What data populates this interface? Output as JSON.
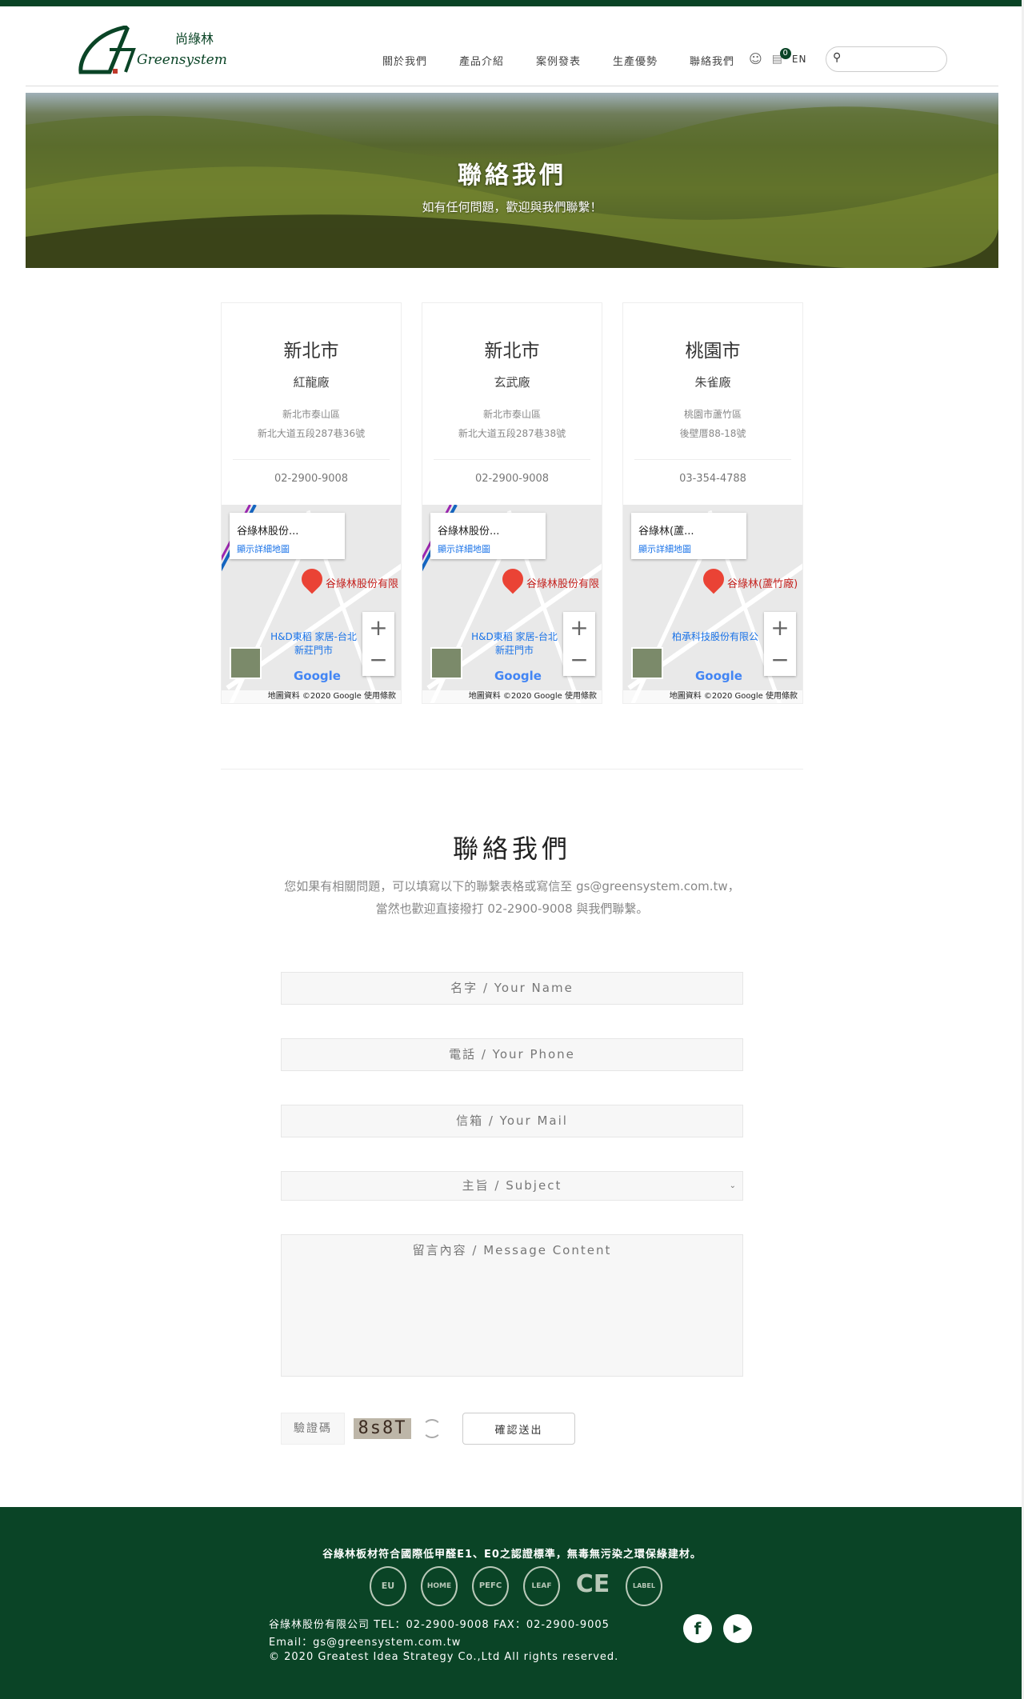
{
  "header": {
    "logo_text": "尚綠林 Greensystem",
    "nav": [
      "關於我們",
      "產品介紹",
      "案例發表",
      "生產優勢",
      "聯絡我們"
    ],
    "cart_count": "0",
    "lang": "EN",
    "search_placeholder": ""
  },
  "hero": {
    "title": "聯絡我們",
    "subtitle": "如有任何問題，歡迎與我們聯繫！"
  },
  "locations": [
    {
      "city": "新北市",
      "factory": "紅龍廠",
      "addr1": "新北市泰山區",
      "addr2": "新北大道五段287巷36號",
      "tel": "02-2900-9008",
      "map_title": "谷綠林股份...",
      "map_link": "顯示詳細地圖",
      "pin_label": "谷綠林股份有限",
      "poi": "H&D東稻 家居-台北新莊門市"
    },
    {
      "city": "新北市",
      "factory": "玄武廠",
      "addr1": "新北市泰山區",
      "addr2": "新北大道五段287巷38號",
      "tel": "02-2900-9008",
      "map_title": "谷綠林股份...",
      "map_link": "顯示詳細地圖",
      "pin_label": "谷綠林股份有限",
      "poi": "H&D東稻 家居-台北新莊門市"
    },
    {
      "city": "桃園市",
      "factory": "朱雀廠",
      "addr1": "桃園市蘆竹區",
      "addr2": "後壁厝88-18號",
      "tel": "03-354-4788",
      "map_title": "谷綠林(蘆...",
      "map_link": "顯示詳細地圖",
      "pin_label": "谷綠林(蘆竹廠)",
      "poi": "柏承科技股份有限公"
    }
  ],
  "map_common": {
    "google": "Google",
    "attribution": "地圖資料 ©2020 Google  使用條款"
  },
  "contact": {
    "title": "聯絡我們",
    "line1": "您如果有相關問題，可以填寫以下的聯繫表格或寫信至 gs@greensystem.com.tw，",
    "line2": "當然也歡迎直接撥打 02-2900-9008 與我們聯繫。"
  },
  "form": {
    "name": "名字 / Your Name",
    "phone": "電話 / Your Phone",
    "mail": "信箱 / Your Mail",
    "subject": "主旨 / Subject",
    "message": "留言內容 / Message Content",
    "captcha_label": "驗證碼",
    "captcha_code": "8s8T",
    "submit": "確認送出"
  },
  "footer": {
    "statement": "谷綠林板材符合國際低甲醛E1、E0之認證標準，無毒無污染之環保綠建材。",
    "certs": [
      "EU",
      "HOME",
      "PEFC",
      "LEAF",
      "CE",
      "LABEL"
    ],
    "company": "谷綠林股份有限公司 TEL：02-2900-9008  FAX：02-2900-9005",
    "email": "Email：gs@greensystem.com.tw",
    "copyright": "© 2020 Greatest Idea Strategy Co.,Ltd All rights reserved.",
    "social": [
      "facebook",
      "youtube"
    ]
  },
  "colors": {
    "brand": "#0a4426",
    "pin": "#ea4335",
    "link": "#1a73e8"
  }
}
